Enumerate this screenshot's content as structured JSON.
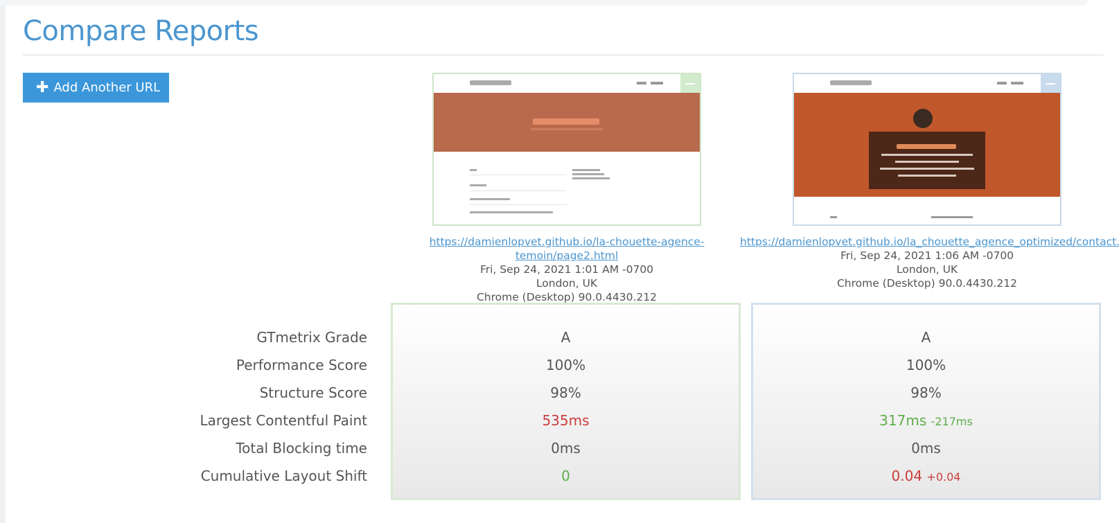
{
  "page": {
    "title": "Compare Reports"
  },
  "toolbar": {
    "add_url_label": "Add Another URL",
    "add_url_icon": "plus-icon"
  },
  "metrics_labels": [
    "GTmetrix Grade",
    "Performance Score",
    "Structure Score",
    "Largest Contentful Paint",
    "Total Blocking time",
    "Cumulative Layout Shift"
  ],
  "reports": [
    {
      "url": "https://damienlopvet.github.io/la-chouette-agence-temoin/page2.html",
      "date": "Fri, Sep 24, 2021 1:01 AM -0700",
      "location": "London, UK",
      "browser": "Chrome (Desktop) 90.0.4430.212",
      "accent_color": "#cfe6c8",
      "metrics": {
        "grade": "A",
        "performance": "100%",
        "structure": "98%",
        "lcp": "535ms",
        "lcp_delta": "",
        "tbt": "0ms",
        "cls": "0",
        "cls_delta": ""
      }
    },
    {
      "url": "https://damienlopvet.github.io/la_chouette_agence_optimized/contact.html",
      "date": "Fri, Sep 24, 2021 1:06 AM -0700",
      "location": "London, UK",
      "browser": "Chrome (Desktop) 90.0.4430.212",
      "accent_color": "#c7d9ea",
      "screenshot_text": {
        "heading": "Parlons web design !",
        "body": "Nous sommes ravis que vous souhaitiez collaborer avec notre agence. Parlez-nous de votre projet en complétant le formulaire ci-dessous."
      },
      "metrics": {
        "grade": "A",
        "performance": "100%",
        "structure": "98%",
        "lcp": "317ms",
        "lcp_delta": "-217ms",
        "tbt": "0ms",
        "cls": "0.04",
        "cls_delta": "+0.04"
      }
    }
  ],
  "colors": {
    "title": "#4a95cf",
    "button": "#3b97da",
    "better": "#5eae4a",
    "worse": "#cc3c3c"
  }
}
